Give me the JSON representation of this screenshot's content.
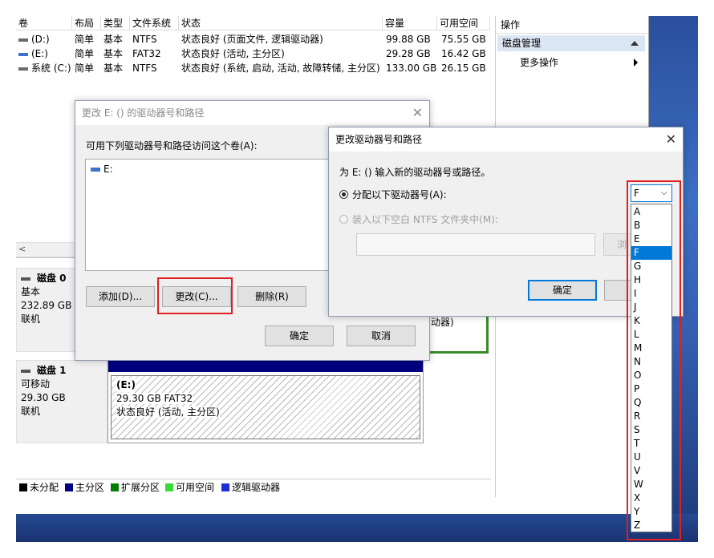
{
  "table": {
    "headers": [
      "卷",
      "布局",
      "类型",
      "文件系统",
      "状态",
      "容量",
      "可用空间"
    ],
    "rows": [
      {
        "vol": "(D:)",
        "layout": "简单",
        "type": "基本",
        "fs": "NTFS",
        "status": "状态良好 (页面文件, 逻辑驱动器)",
        "cap": "99.88 GB",
        "free": "75.55 GB"
      },
      {
        "vol": "(E:)",
        "layout": "简单",
        "type": "基本",
        "fs": "FAT32",
        "status": "状态良好 (活动, 主分区)",
        "cap": "29.28 GB",
        "free": "16.42 GB"
      },
      {
        "vol": "系统 (C:)",
        "layout": "简单",
        "type": "基本",
        "fs": "NTFS",
        "status": "状态良好 (系统, 启动, 活动, 故障转储, 主分区)",
        "cap": "133.00 GB",
        "free": "26.15 GB"
      }
    ]
  },
  "actions": {
    "title": "操作",
    "section": "磁盘管理",
    "more": "更多操作"
  },
  "disks": [
    {
      "name": "磁盘 0",
      "type": "基本",
      "size": "232.89 GB",
      "state": "联机"
    },
    {
      "name": "磁盘 1",
      "type": "可移动",
      "size": "29.30 GB",
      "state": "联机"
    }
  ],
  "partition_e": {
    "name": "(E:)",
    "size": "29.30 GB FAT32",
    "status": "状态良好 (活动, 主分区)"
  },
  "hidden_fragment": "动器)",
  "legend": [
    "未分配",
    "主分区",
    "扩展分区",
    "可用空间",
    "逻辑驱动器"
  ],
  "legend_colors": [
    "#000000",
    "#000080",
    "#008000",
    "#3ad93a",
    "#1f2fd6"
  ],
  "dialog1": {
    "title": "更改 E: () 的驱动器号和路径",
    "prompt": "可用下列驱动器号和路径访问这个卷(A):",
    "list_item": "E:",
    "add": "添加(D)...",
    "change": "更改(C)...",
    "remove": "删除(R)",
    "ok": "确定",
    "cancel": "取消"
  },
  "dialog2": {
    "title": "更改驱动器号和路径",
    "prompt": "为 E: () 输入新的驱动器号或路径。",
    "radio1": "分配以下驱动器号(A):",
    "radio2": "装入以下空白 NTFS 文件夹中(M):",
    "browse_fragment": "浏",
    "ok": "确定",
    "selected_letter": "F"
  },
  "dropdown": {
    "options": [
      "A",
      "B",
      "E",
      "F",
      "G",
      "H",
      "I",
      "J",
      "K",
      "L",
      "M",
      "N",
      "O",
      "P",
      "Q",
      "R",
      "S",
      "T",
      "U",
      "V",
      "W",
      "X",
      "Y",
      "Z"
    ],
    "selected_index": 3
  }
}
